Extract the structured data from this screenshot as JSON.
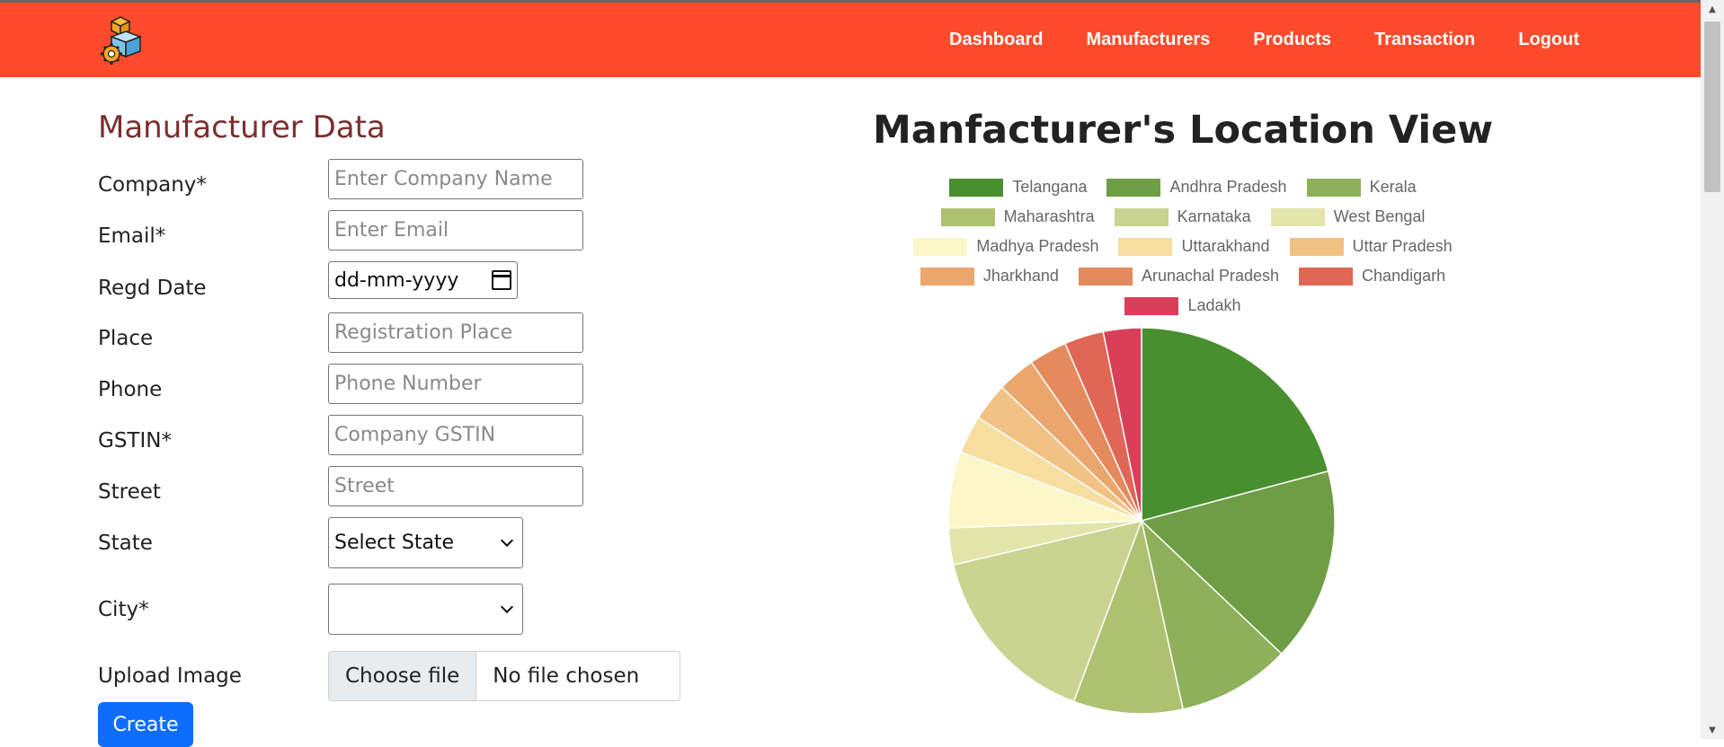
{
  "navbar": {
    "logo_icon": "boxes-gear-icon",
    "links": [
      "Dashboard",
      "Manufacturers",
      "Products",
      "Transaction",
      "Logout"
    ]
  },
  "form": {
    "title": "Manufacturer Data",
    "labels": {
      "company": "Company*",
      "email": "Email*",
      "regd_date": "Regd Date",
      "place": "Place",
      "phone": "Phone",
      "gstin": "GSTIN*",
      "street": "Street",
      "state": "State",
      "city": "City*",
      "upload": "Upload Image"
    },
    "placeholders": {
      "company": "Enter Company Name",
      "email": "Enter Email",
      "place": "Registration Place",
      "phone": "Phone Number",
      "gstin": "Company GSTIN",
      "street": "Street"
    },
    "date_value": "dd-mm-yyyy",
    "state_selected": "Select State",
    "city_selected": "",
    "file_button": "Choose file",
    "file_status": "No file chosen",
    "create_button": "Create"
  },
  "chart_data": {
    "type": "pie",
    "title": "Manfacturer's Location View",
    "legend_position": "top",
    "categories": [
      "Telangana",
      "Andhra Pradesh",
      "Kerala",
      "Maharashtra",
      "Karnataka",
      "West Bengal",
      "Madhya Pradesh",
      "Uttarakhand",
      "Uttar Pradesh",
      "Jharkhand",
      "Arunachal Pradesh",
      "Chandigarh",
      "Ladakh"
    ],
    "values": [
      20.3,
      15.8,
      9.2,
      8.9,
      15.2,
      3.0,
      6.2,
      3.1,
      3.1,
      3.1,
      3.1,
      3.2,
      3.1
    ],
    "colors": [
      "#4a8f2f",
      "#6d9e45",
      "#8fb05b",
      "#adc171",
      "#cad491",
      "#e3e4aa",
      "#fcf7c8",
      "#f7dda0",
      "#f2c284",
      "#ebA66e",
      "#e58a5d",
      "#e06655",
      "#d93f58"
    ]
  }
}
